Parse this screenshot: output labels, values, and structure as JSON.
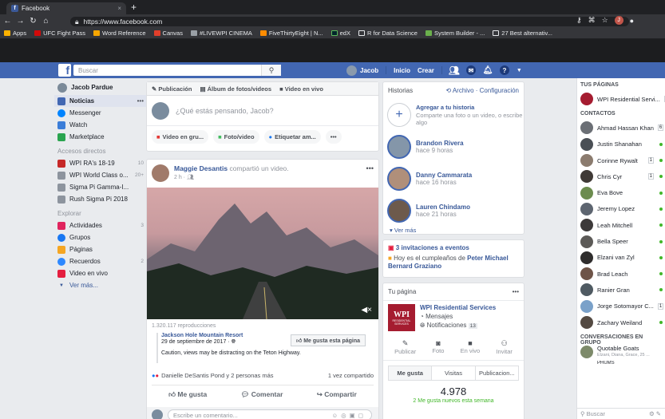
{
  "browser": {
    "tab_title": "Facebook",
    "url": "https://www.facebook.com",
    "profile_initial": "J",
    "bookmarks": [
      "Apps",
      "UFC Fight Pass",
      "Word Reference",
      "Canvas",
      "#LIVEWPI CINEMA",
      "FiveThirtyEight | N...",
      "edX",
      "R for Data Science",
      "System Builder - ...",
      "27 Best alternativ..."
    ]
  },
  "header": {
    "logo": "f",
    "search_placeholder": "Buscar",
    "user_name": "Jacob",
    "nav_home": "Inicio",
    "nav_create": "Crear"
  },
  "left": {
    "profile": "Jacob Pardue",
    "items": [
      {
        "label": "Noticias",
        "extra": "•••"
      },
      {
        "label": "Messenger"
      },
      {
        "label": "Watch"
      },
      {
        "label": "Marketplace"
      }
    ],
    "shortcuts_title": "Accesos directos",
    "shortcuts": [
      {
        "label": "WPI RA's 18-19",
        "count": "10"
      },
      {
        "label": "WPI World Class o...",
        "count": "20+"
      },
      {
        "label": "Sigma Pi Gamma-I..."
      },
      {
        "label": "Rush Sigma Pi 2018"
      }
    ],
    "explore_title": "Explorar",
    "explore": [
      {
        "label": "Actividades",
        "count": "3"
      },
      {
        "label": "Grupos"
      },
      {
        "label": "Páginas"
      },
      {
        "label": "Recuerdos",
        "count": "2"
      },
      {
        "label": "Video en vivo"
      }
    ],
    "see_more": "Ver más..."
  },
  "composer": {
    "tab_post": "Publicación",
    "tab_album": "Álbum de fotos/videos",
    "tab_live": "Video en vivo",
    "placeholder": "¿Qué estás pensando, Jacob?",
    "btn_video": "Video en gru...",
    "btn_photo": "Foto/video",
    "btn_tag": "Etiquetar am...",
    "btn_more": "•••"
  },
  "post": {
    "author": "Maggie Desantis",
    "action": "compartió un video.",
    "time": "2 h ·",
    "more": "•••",
    "views": "1.320.117 reproducciones",
    "page_name": "Jackson Hole Mountain Resort",
    "page_date": "29 de septiembre de 2017 ·",
    "like_page": "Me gusta esta página",
    "caption": "Caution, views may be distracting on the Teton Highway.",
    "reactions": "Danielle DeSantis Pond y 2 personas más",
    "shares": "1 vez compartido",
    "like": "Me gusta",
    "comment": "Comentar",
    "share": "Compartir",
    "comment_placeholder": "Escribe un comentario..."
  },
  "stories": {
    "title": "Historias",
    "links": "Archivo · Configuración",
    "add_title": "Agregar a tu historia",
    "add_sub": "Comparte una foto o un video, o escribe algo",
    "items": [
      {
        "name": "Brandon Rivera",
        "time": "hace 9 horas"
      },
      {
        "name": "Danny Cammarata",
        "time": "hace 16 horas"
      },
      {
        "name": "Lauren Chindamo",
        "time": "hace 21 horas"
      }
    ],
    "see_more": "Ver más"
  },
  "events": {
    "invites": "3 invitaciones a eventos",
    "birthday_prefix": "Hoy es el cumpleaños de",
    "birthday_name": "Peter Michael Bernard Graziano"
  },
  "mypage": {
    "title": "Tu página",
    "more": "•••",
    "name": "WPI Residential Services",
    "messages": "Mensajes",
    "notifications": "Notificaciones",
    "notif_count": "13",
    "logo_text": "WPI",
    "logo_sub": "RESIDENTIAL SERVICES",
    "actions": [
      "Publicar",
      "Foto",
      "En vivo",
      "Invitar"
    ],
    "tabs": [
      "Me gusta",
      "Visitas",
      "Publicacion..."
    ],
    "likes_count": "4.978",
    "likes_week": "2 Me gusta nuevos esta semana"
  },
  "sidebar": {
    "pages_title": "TUS PÁGINAS",
    "page_item": "WPI Residential Servi...",
    "page_count": "9",
    "contacts_title": "CONTACTOS",
    "contacts": [
      {
        "name": "Ahmad Hassan Khan",
        "badge": "6"
      },
      {
        "name": "Justin Shanahan"
      },
      {
        "name": "Corinne Rywalt",
        "badge": "1"
      },
      {
        "name": "Chris Cyr",
        "badge": "1"
      },
      {
        "name": "Eva Bove"
      },
      {
        "name": "Jeremy Lopez"
      },
      {
        "name": "Leah Mitchell"
      },
      {
        "name": "Bella Speer"
      },
      {
        "name": "Elzani van Zyl"
      },
      {
        "name": "Brad Leach"
      },
      {
        "name": "Ranier Gran"
      },
      {
        "name": "Jorge Sotomayor C...",
        "badge": "1"
      },
      {
        "name": "Zachary Weiland"
      }
    ],
    "groups_title": "CONVERSACIONES EN GRUPO",
    "group_name": "Quotable Goats",
    "group_members": "Elzani, Diana, Grace, 25 ...",
    "group2": "PHUMS",
    "search_placeholder": "Buscar"
  },
  "colors": {
    "fb_blue": "#4267b2",
    "link": "#385898",
    "online": "#42b72a"
  }
}
